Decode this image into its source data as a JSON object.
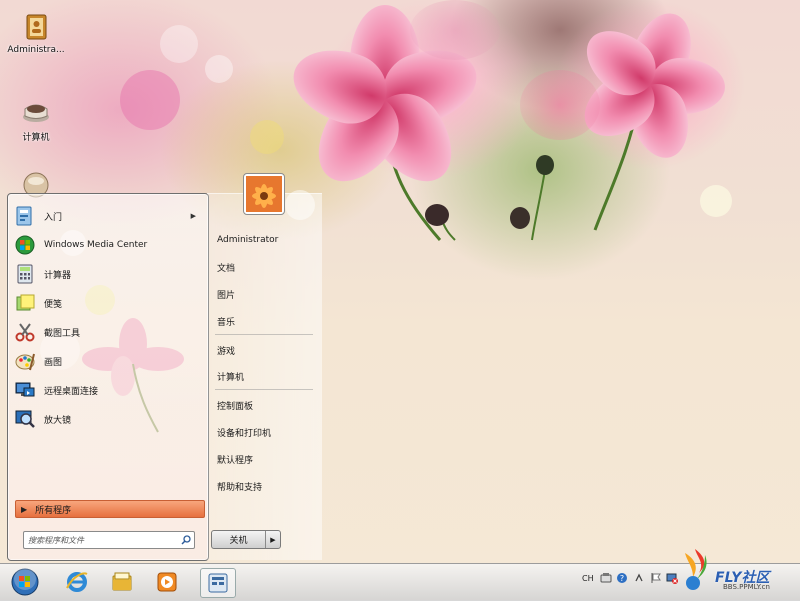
{
  "desktop": {
    "icons": [
      {
        "label": "Administra...",
        "icon": "contacts-book-icon"
      },
      {
        "label": "计算机",
        "icon": "computer-icon"
      },
      {
        "label": "",
        "icon": "network-icon"
      }
    ]
  },
  "start_menu": {
    "programs": [
      {
        "label": "入门",
        "icon": "getting-started-icon",
        "has_submenu": true
      },
      {
        "label": "Windows Media Center",
        "icon": "media-center-icon",
        "has_submenu": false
      },
      {
        "label": "计算器",
        "icon": "calculator-icon",
        "has_submenu": false
      },
      {
        "label": "便笺",
        "icon": "sticky-notes-icon",
        "has_submenu": false
      },
      {
        "label": "截图工具",
        "icon": "snipping-tool-icon",
        "has_submenu": false
      },
      {
        "label": "画图",
        "icon": "paint-icon",
        "has_submenu": false
      },
      {
        "label": "远程桌面连接",
        "icon": "remote-desktop-icon",
        "has_submenu": false
      },
      {
        "label": "放大镜",
        "icon": "magnifier-icon",
        "has_submenu": false
      }
    ],
    "all_programs_label": "所有程序",
    "search_placeholder": "搜索程序和文件",
    "places": {
      "user": "Administrator",
      "documents": "文档",
      "pictures": "图片",
      "music": "音乐",
      "games": "游戏",
      "computer": "计算机",
      "control_panel": "控制面板",
      "devices_printers": "设备和打印机",
      "default_programs": "默认程序",
      "help_support": "帮助和支持"
    },
    "shutdown_label": "关机",
    "accent": "#e6703f"
  },
  "taskbar": {
    "items": [
      "start-orb-icon",
      "internet-explorer-icon",
      "windows-explorer-icon",
      "media-player-icon",
      "start-menu-active-icon"
    ],
    "tray": {
      "ime": "CH"
    }
  },
  "watermark": {
    "brand": "FLY社区",
    "sub": "BBS.PPMLY.cn"
  }
}
